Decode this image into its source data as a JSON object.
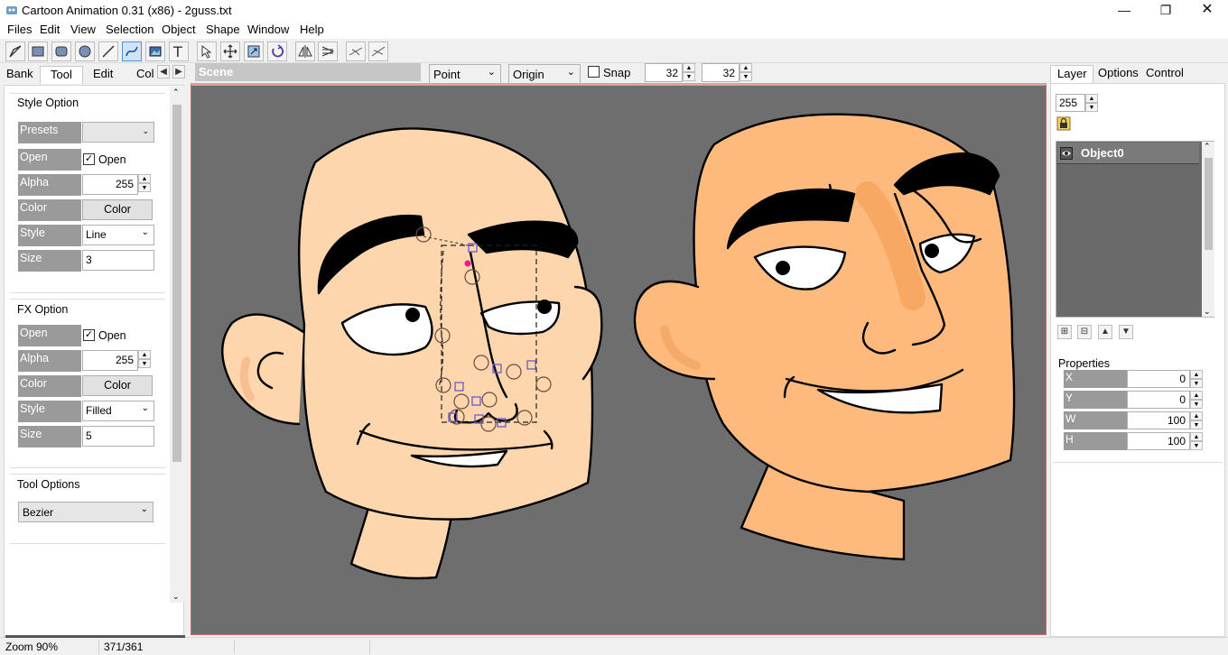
{
  "window": {
    "title": "Cartoon Animation 0.31 (x86) - 2guss.txt"
  },
  "menu": [
    "Files",
    "Edit",
    "View",
    "Selection",
    "Object",
    "Shape",
    "Window",
    "Help"
  ],
  "toolbar": {
    "tools": [
      "pen-tool-icon",
      "rectangle-icon",
      "rounded-rectangle-icon",
      "ellipse-icon",
      "line-icon",
      "bezier-curve-icon",
      "image-icon",
      "text-icon",
      "select-pointer-icon",
      "move-icon",
      "resize-icon",
      "rotate-icon",
      "flip-horizontal-icon",
      "flip-vertical-icon",
      "node-edit-icon",
      "node-smooth-icon"
    ],
    "active_tool": "bezier-curve-icon"
  },
  "left_panel": {
    "tabs": [
      "Bank",
      "Tool",
      "Edit",
      "Col"
    ],
    "selected_tab": "Tool",
    "style_option": {
      "title": "Style Option",
      "presets_label": "Presets",
      "presets_value": "",
      "open_label": "Open",
      "open_check_label": "Open",
      "alpha_label": "Alpha",
      "alpha_value": "255",
      "color_label": "Color",
      "color_button": "Color",
      "style_label": "Style",
      "style_value": "Line",
      "size_label": "Size",
      "size_value": "3"
    },
    "fx_option": {
      "title": "FX Option",
      "open_label": "Open",
      "open_check_label": "Open",
      "alpha_label": "Alpha",
      "alpha_value": "255",
      "color_label": "Color",
      "color_button": "Color",
      "style_label": "Style",
      "style_value": "Filled",
      "size_label": "Size",
      "size_value": "5"
    },
    "tool_options": {
      "title": "Tool Options",
      "value": "Bezier"
    }
  },
  "scene": {
    "title": "Scene",
    "point_select": "Point",
    "origin_select": "Origin",
    "snap_label": "Snap",
    "snap_x": "32",
    "snap_y": "32"
  },
  "right_panel": {
    "tabs": [
      "Layer",
      "Options",
      "Control"
    ],
    "selected_tab": "Layer",
    "alpha_value": "255",
    "layers": [
      "Object0"
    ],
    "properties_title": "Properties",
    "props": [
      {
        "label": "X",
        "value": "0"
      },
      {
        "label": "Y",
        "value": "0"
      },
      {
        "label": "W",
        "value": "100"
      },
      {
        "label": "H",
        "value": "100"
      }
    ]
  },
  "status": {
    "zoom": "Zoom 90%",
    "coords": "371/361"
  },
  "colors": {
    "skin_light": "#fdd6ae",
    "skin_dark": "#fdba7c",
    "canvas_bg": "#6e6e6e",
    "panel_label_bg": "#9a9a9a"
  }
}
